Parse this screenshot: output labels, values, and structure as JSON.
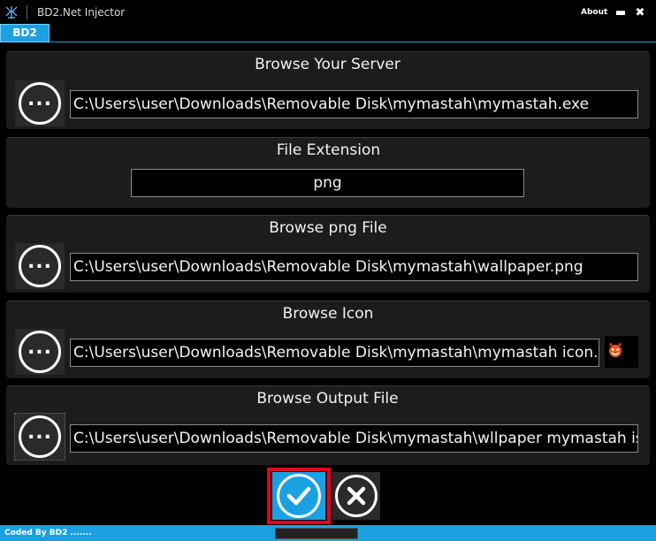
{
  "window": {
    "title": "BD2.Net Injector",
    "about_label": "About",
    "minimize_glyph": "▬",
    "close_glyph": "✖"
  },
  "tabs": [
    {
      "label": "BD2",
      "active": true
    }
  ],
  "sections": {
    "server": {
      "title": "Browse Your Server",
      "value": "C:\\Users\\user\\Downloads\\Removable Disk\\mymastah\\mymastah.exe",
      "browse_label": "..."
    },
    "extension": {
      "title": "File Extension",
      "value": "png"
    },
    "png_file": {
      "title": "Browse png File",
      "value": "C:\\Users\\user\\Downloads\\Removable Disk\\mymastah\\wallpaper.png",
      "browse_label": "..."
    },
    "icon": {
      "title": "Browse Icon",
      "value": "C:\\Users\\user\\Downloads\\Removable Disk\\mymastah\\mymastah icon.ico",
      "browse_label": "...",
      "preview_icon": "devil-face-icon"
    },
    "output": {
      "title": "Browse Output File",
      "value": "C:\\Users\\user\\Downloads\\Removable Disk\\mymastah\\wllpaper mymastah isl",
      "browse_label": "..."
    }
  },
  "actions": {
    "ok_icon": "checkmark-icon",
    "cancel_icon": "x-icon"
  },
  "status": {
    "text": "Coded By BD2 ......."
  },
  "colors": {
    "accent": "#1ba1e2",
    "highlight": "#e8001c",
    "panel": "#1c1c1c"
  }
}
